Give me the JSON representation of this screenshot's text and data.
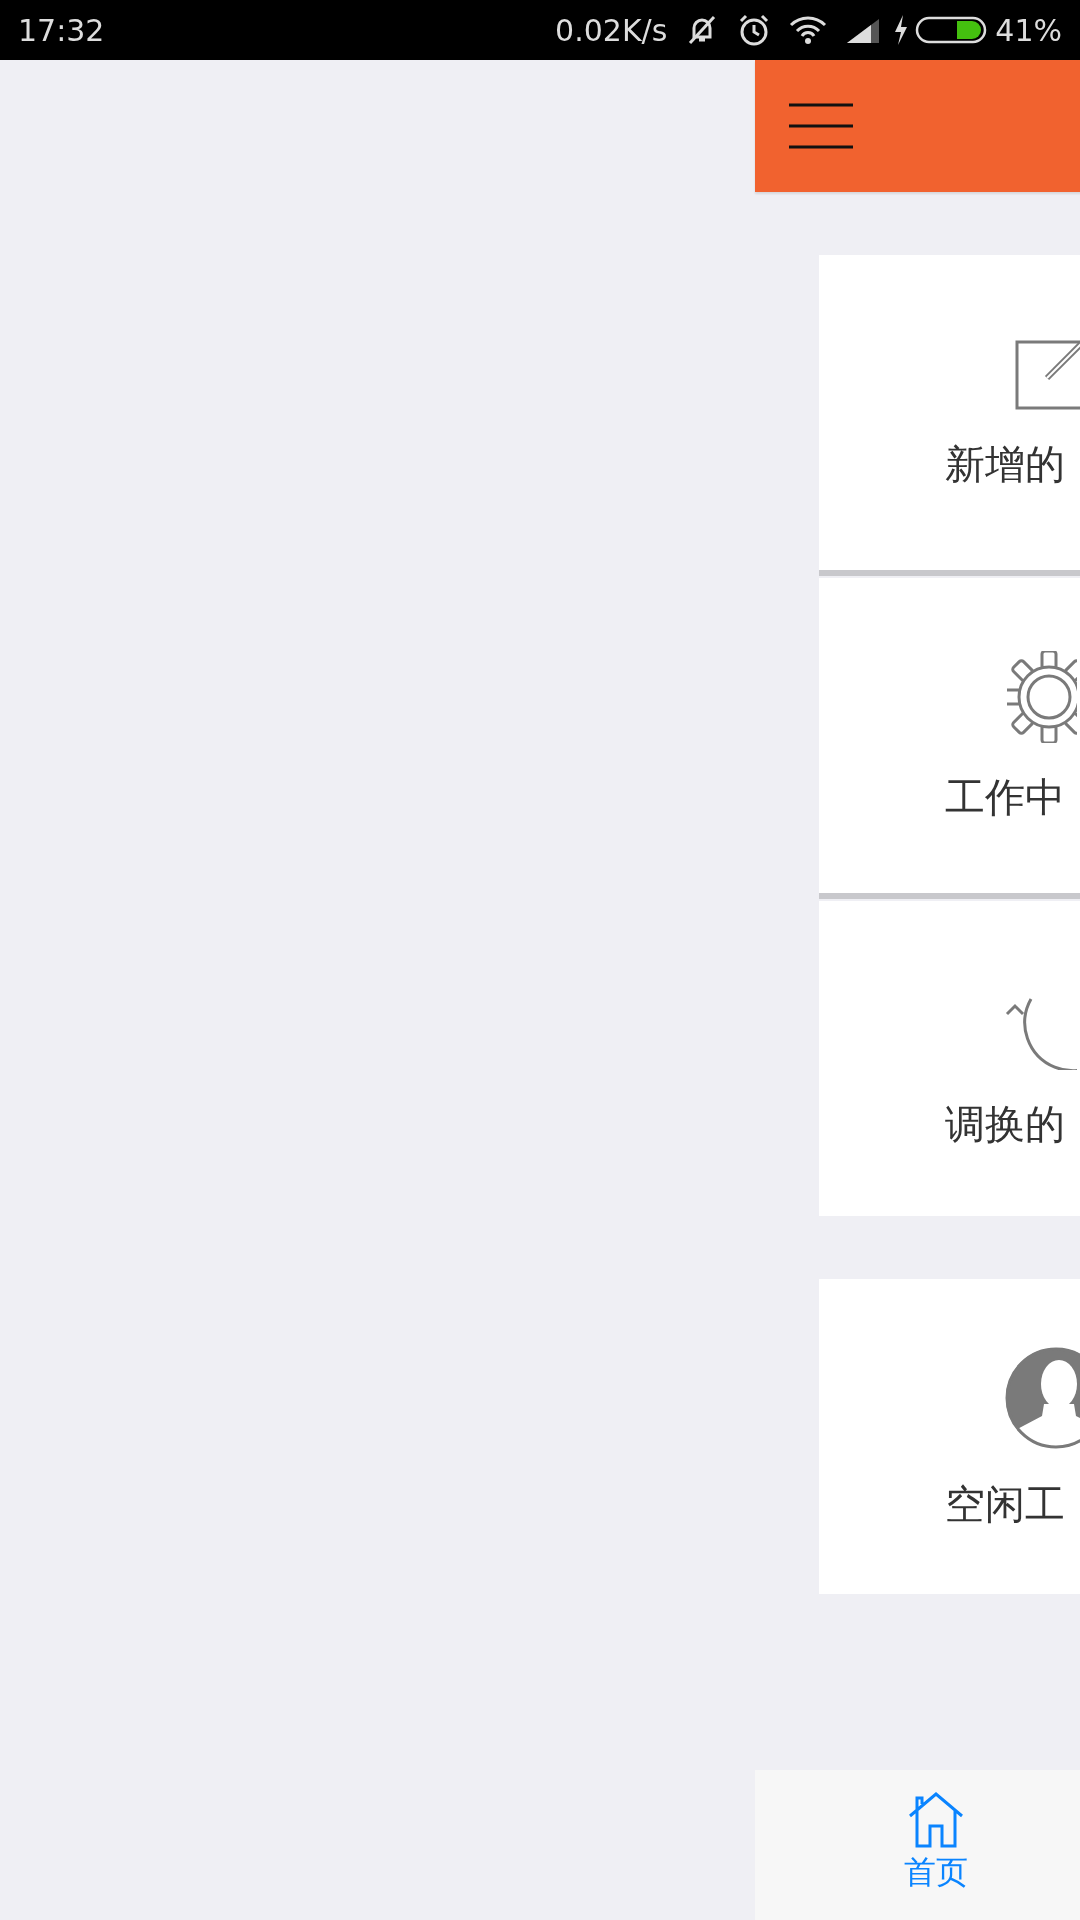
{
  "status_bar": {
    "time": "17:32",
    "speed": "0.02K/s",
    "battery": "41%"
  },
  "cards": [
    {
      "kind": "edit",
      "label": "新增的"
    },
    {
      "kind": "gear",
      "label": "工作中"
    },
    {
      "kind": "refresh",
      "label": "调换的"
    },
    {
      "kind": "person",
      "label": "空闲工"
    }
  ],
  "tab_bar": [
    {
      "label": "首页",
      "selected": true
    }
  ]
}
